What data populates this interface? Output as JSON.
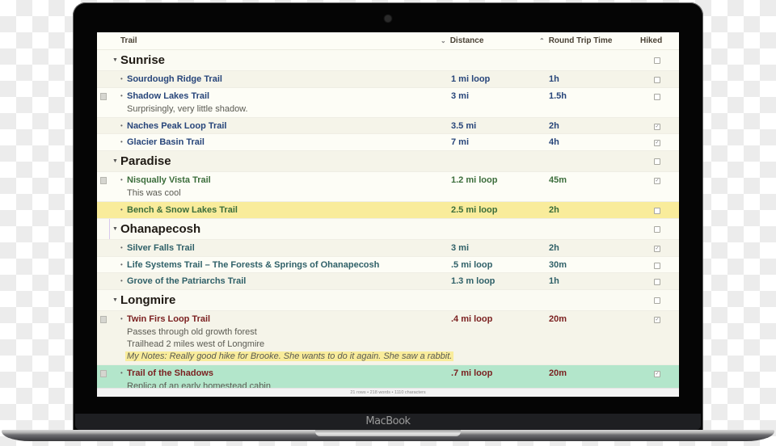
{
  "device": {
    "brand_label": "MacBook"
  },
  "app": {
    "columns": {
      "trail": "Trail",
      "distance": "Distance",
      "distance_sort_glyph": "⌄",
      "round_trip_time": "Round Trip Time",
      "round_trip_time_sort_glyph": "⌃",
      "hiked": "Hiked"
    },
    "colors": {
      "sunrise_text": "#27457a",
      "paradise_text": "#3b6d3b",
      "ohanapecosh_text": "#2f6068",
      "longmire_text": "#7a1f1f",
      "highlight_yellow": "#f9ec9b",
      "highlight_green": "#b3e6cb"
    },
    "groups": [
      {
        "name": "Sunrise",
        "hiked": false,
        "trails": [
          {
            "name": "Sourdough Ridge Trail",
            "distance": "1 mi loop",
            "time": "1h",
            "hiked": false,
            "notes": []
          },
          {
            "name": "Shadow Lakes Trail",
            "distance": "3 mi",
            "time": "1.5h",
            "hiked": false,
            "notes": [
              "Surprisingly, very little shadow."
            ]
          },
          {
            "name": "Naches Peak Loop Trail",
            "distance": "3.5 mi",
            "time": "2h",
            "hiked": true,
            "notes": []
          },
          {
            "name": "Glacier Basin Trail",
            "distance": "7 mi",
            "time": "4h",
            "hiked": true,
            "notes": []
          }
        ]
      },
      {
        "name": "Paradise",
        "hiked": false,
        "trails": [
          {
            "name": "Nisqually Vista Trail",
            "distance": "1.2 mi loop",
            "time": "45m",
            "hiked": true,
            "notes": [
              "This was cool"
            ]
          },
          {
            "name": "Bench & Snow Lakes Trail",
            "distance": "2.5 mi loop",
            "time": "2h",
            "hiked": false,
            "notes": []
          }
        ]
      },
      {
        "name": "Ohanapecosh",
        "hiked": false,
        "trails": [
          {
            "name": "Silver Falls Trail",
            "distance": "3 mi",
            "time": "2h",
            "hiked": true,
            "notes": []
          },
          {
            "name": "Life Systems Trail – The Forests & Springs of Ohanapecosh",
            "distance": ".5 mi loop",
            "time": "30m",
            "hiked": false,
            "notes": []
          },
          {
            "name": "Grove of the Patriarchs Trail",
            "distance": "1.3 m loop",
            "time": "1h",
            "hiked": false,
            "notes": []
          }
        ]
      },
      {
        "name": "Longmire",
        "hiked": false,
        "trails": [
          {
            "name": "Twin Firs Loop Trail",
            "distance": ".4 mi loop",
            "time": "20m",
            "hiked": true,
            "notes": [
              "Passes through old growth forest",
              "Trailhead 2 miles west of Longmire"
            ],
            "my_notes": "My Notes: Really good hike for Brooke. She wants to do it again. She saw a rabbit."
          },
          {
            "name": "Trail of the Shadows",
            "distance": ".7 mi loop",
            "time": "20m",
            "hiked": true,
            "notes": [
              "Replica of an early homestead cabin"
            ]
          }
        ]
      }
    ],
    "status_bar": "21 rows • 218 words • 1110 characters"
  }
}
